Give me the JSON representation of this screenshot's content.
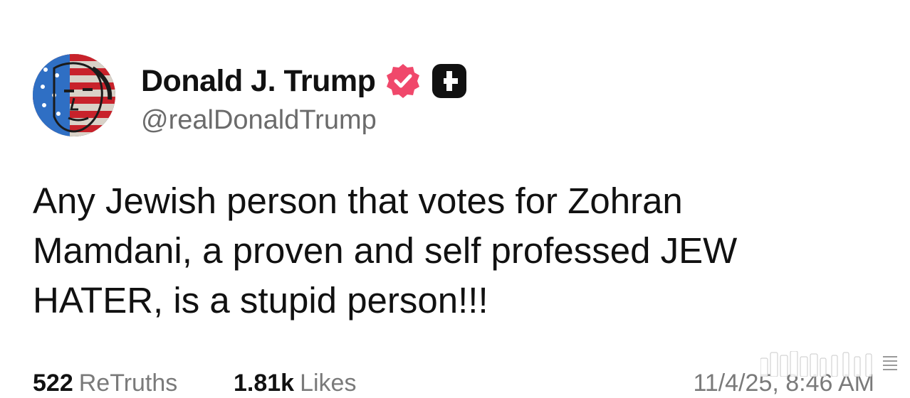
{
  "author": {
    "display_name": "Donald J. Trump",
    "handle": "@realDonaldTrump",
    "avatar_icon": "flag-face-avatar",
    "verified_icon": "verified-badge-icon",
    "extra_icon": "plus-badge-icon"
  },
  "post": {
    "lines": [
      "Any Jewish person that votes for Zohran",
      "Mamdani, a proven and self professed JEW",
      "HATER, is a stupid person!!!"
    ]
  },
  "stats": {
    "retruths_count": "522",
    "retruths_label": "ReTruths",
    "likes_count": "1.81k",
    "likes_label": "Likes"
  },
  "timestamp": "11/4/25, 8:46 AM",
  "colors": {
    "verified": "#f0486b",
    "badge_dark": "#111111",
    "muted": "#6b6b6b"
  }
}
